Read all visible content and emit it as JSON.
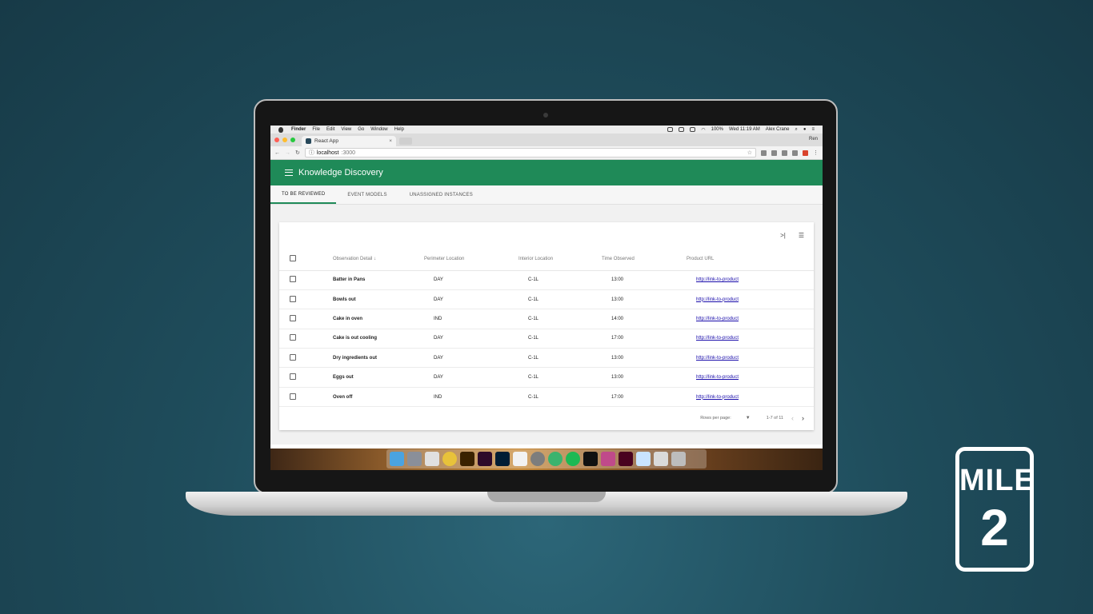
{
  "menubar": {
    "app": "Finder",
    "items": [
      "File",
      "Edit",
      "View",
      "Go",
      "Window",
      "Help"
    ],
    "battery": "100%",
    "clock": "Wed 11:19 AM",
    "user": "Alex Crane"
  },
  "browser": {
    "tab_title": "React App",
    "tab_close": "×",
    "profile": "Ren",
    "url_host": "localhost",
    "url_port": ":3000"
  },
  "app": {
    "title": "Knowledge Discovery",
    "tabs": [
      {
        "label": "TO BE REVIEWED",
        "active": true
      },
      {
        "label": "EVENT MODELS",
        "active": false
      },
      {
        "label": "UNASSIGNED INSTANCES",
        "active": false
      }
    ],
    "columns": {
      "detail": "Observation Detail",
      "perimeter": "Perimeter Location",
      "interior": "Interior Location",
      "time": "Time Observed",
      "url": "Product URL"
    },
    "rows": [
      {
        "detail": "Batter in Pans",
        "perimeter": "DAY",
        "interior": "C-1L",
        "time": "13:00",
        "url": "http://link-to-product"
      },
      {
        "detail": "Bowls out",
        "perimeter": "DAY",
        "interior": "C-1L",
        "time": "13:00",
        "url": "http://link-to-product"
      },
      {
        "detail": "Cake in oven",
        "perimeter": "IND",
        "interior": "C-1L",
        "time": "14:00",
        "url": "http://link-to-product"
      },
      {
        "detail": "Cake is out cooling",
        "perimeter": "DAY",
        "interior": "C-1L",
        "time": "17:00",
        "url": "http://link-to-product"
      },
      {
        "detail": "Dry ingredients out",
        "perimeter": "DAY",
        "interior": "C-1L",
        "time": "13:00",
        "url": "http://link-to-product"
      },
      {
        "detail": "Eggs out",
        "perimeter": "DAY",
        "interior": "C-1L",
        "time": "13:00",
        "url": "http://link-to-product"
      },
      {
        "detail": "Oven off",
        "perimeter": "IND",
        "interior": "C-1L",
        "time": "17:00",
        "url": "http://link-to-product"
      }
    ],
    "pagination": {
      "rows_per_page_label": "Rows per page:",
      "range": "1-7 of 11"
    }
  },
  "badge": {
    "line1": "MILE",
    "line2": "2"
  },
  "colors": {
    "appbar": "#1f8a58",
    "background": "#1f4d5c"
  }
}
